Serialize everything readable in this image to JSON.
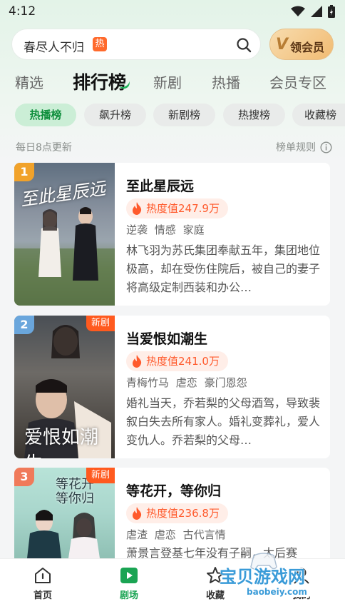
{
  "status_bar": {
    "time": "4:12"
  },
  "search": {
    "query": "春尽人不归",
    "hot_tag": "热"
  },
  "vip": {
    "v": "V",
    "label": "领会员"
  },
  "main_tabs": [
    {
      "label": "精选"
    },
    {
      "label": "排行榜"
    },
    {
      "label": "新剧"
    },
    {
      "label": "热播"
    },
    {
      "label": "会员专区"
    }
  ],
  "sub_tabs": [
    {
      "label": "热播榜"
    },
    {
      "label": "飙升榜"
    },
    {
      "label": "新剧榜"
    },
    {
      "label": "热搜榜"
    },
    {
      "label": "收藏榜"
    }
  ],
  "info": {
    "update_text": "每日8点更新",
    "rules_label": "榜单规则"
  },
  "dramas": [
    {
      "rank": "1",
      "title": "至此星辰远",
      "poster_title": "至此星辰远",
      "heat": "热度值247.9万",
      "tags": [
        "逆袭",
        "情感",
        "家庭"
      ],
      "desc": "林飞羽为苏氏集团奉献五年，集团地位极高，却在受伤住院后，被自己的妻子将高级定制西装和办公…",
      "badge": ""
    },
    {
      "rank": "2",
      "title": "当爱恨如潮生",
      "poster_title": "爱恨如潮生",
      "heat": "热度值241.0万",
      "tags": [
        "青梅竹马",
        "虐恋",
        "豪门恩怨"
      ],
      "desc": "婚礼当天，乔若梨的父母酒驾，导致裴叙白失去所有家人。婚礼变葬礼，爱人变仇人。乔若梨的父母…",
      "badge": "新剧"
    },
    {
      "rank": "3",
      "title": "等花开，等你归",
      "poster_title": "等花开等你归",
      "heat": "热度值236.8万",
      "tags": [
        "虐渣",
        "虐恋",
        "古代言情"
      ],
      "desc": "萧景言登基七年没有子嗣，太后赛",
      "badge": "新剧"
    }
  ],
  "bottom_nav": [
    {
      "label": "首页"
    },
    {
      "label": "剧场"
    },
    {
      "label": "收藏"
    },
    {
      "label": "我的"
    }
  ],
  "watermark": {
    "text": "宝贝游戏网",
    "url": "baobeiy.com"
  },
  "colors": {
    "accent": "#1aa453",
    "heat": "#ff5a2c",
    "new_badge": "#ff5a1f"
  }
}
